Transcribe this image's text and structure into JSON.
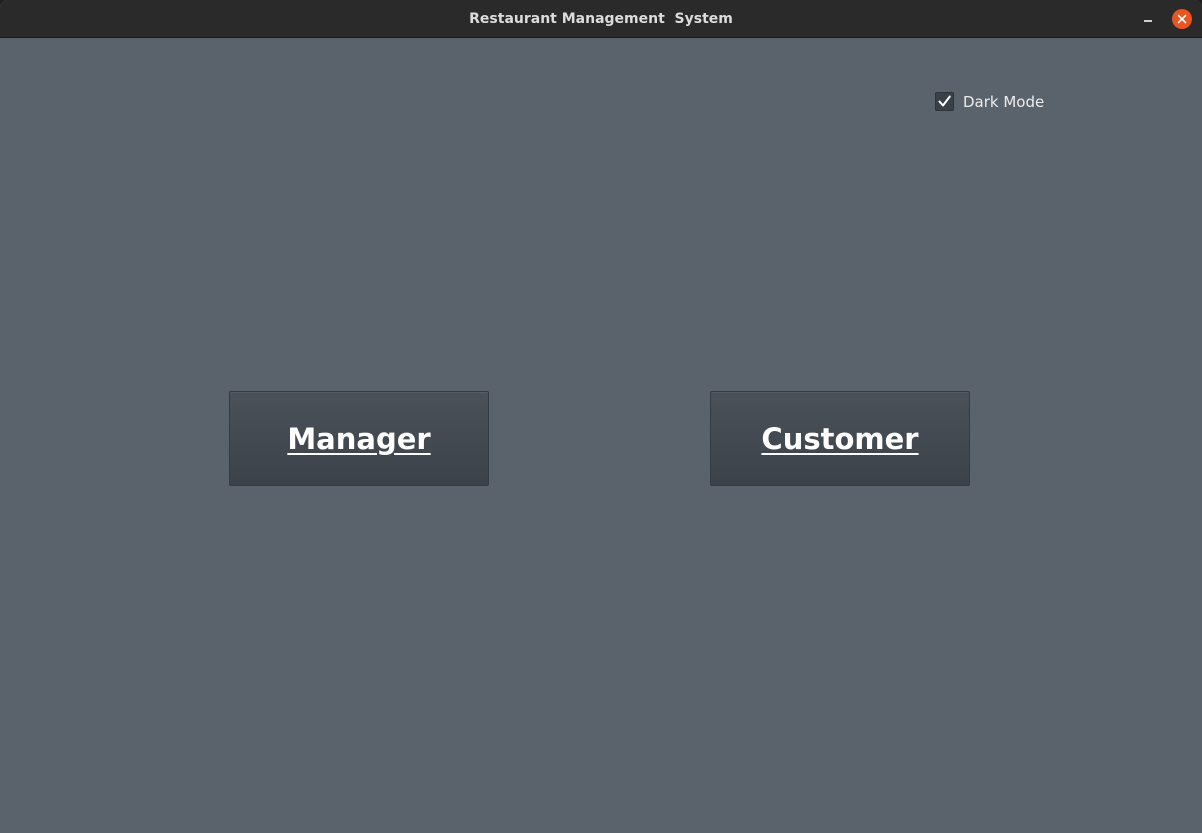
{
  "window": {
    "title": "Restaurant Management  System"
  },
  "controls": {
    "minimize_icon": "minimize-icon",
    "close_icon": "close-icon",
    "close_color": "#e95420"
  },
  "settings": {
    "dark_mode_label": "Dark Mode",
    "dark_mode_checked": true
  },
  "buttons": {
    "manager_label": "Manager",
    "customer_label": "Customer"
  },
  "colors": {
    "background": "#5a636b",
    "titlebar": "#2a2a2a",
    "button": "#434950"
  }
}
